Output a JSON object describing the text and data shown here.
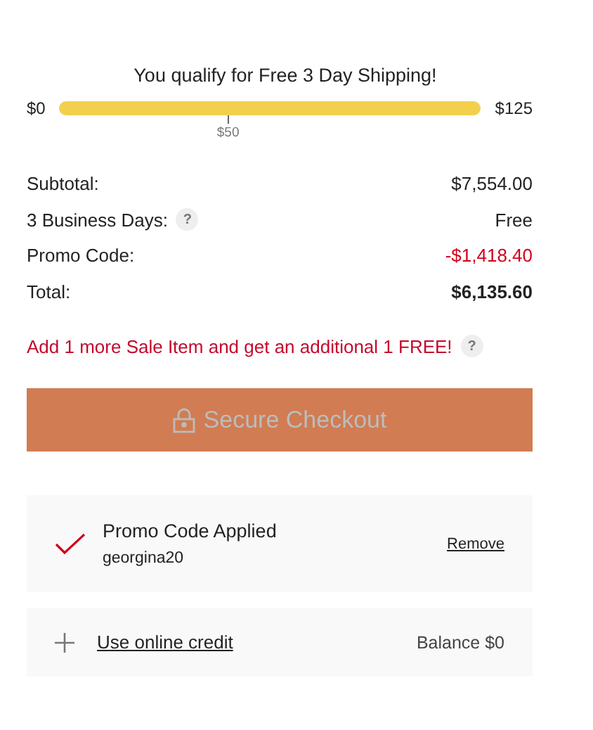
{
  "shipping": {
    "message": "You qualify for Free 3 Day Shipping!",
    "min_label": "$0",
    "max_label": "$125",
    "level": 1,
    "tick_label": "$50"
  },
  "summary": [
    {
      "label": "Subtotal:",
      "value": "$7,554.00",
      "kind": "plain",
      "help": false
    },
    {
      "label": "3 Business Days:",
      "value": "Free",
      "kind": "plain",
      "help": true
    },
    {
      "label": "Promo Code:",
      "value": "-$1,418.40",
      "kind": "discount",
      "help": false
    },
    {
      "label": "Total:",
      "value": "$6,135.60",
      "kind": "total",
      "help": false
    }
  ],
  "sale_notice": {
    "text": "Add 1 more Sale Item and get an additional 1 FREE!",
    "help": "?"
  },
  "help_glyph": "?",
  "checkout_button": {
    "label": "Secure Checkout",
    "disabled": true
  },
  "promo": {
    "title": "Promo Code Applied",
    "code": "georgina20",
    "action": "Remove"
  },
  "credit": {
    "label": "Use online credit",
    "balance": "Balance $0"
  }
}
